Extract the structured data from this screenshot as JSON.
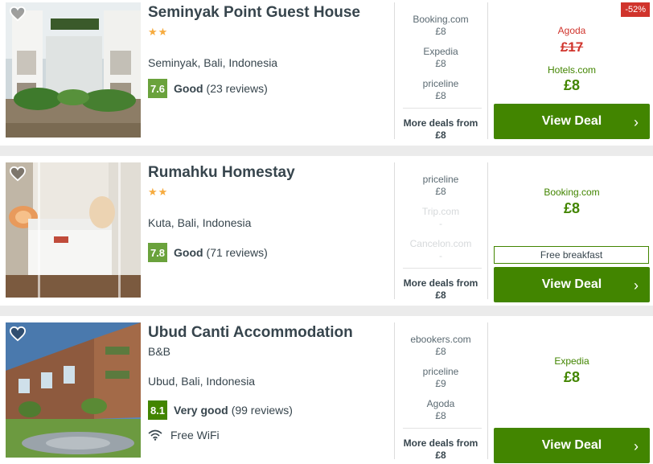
{
  "results": [
    {
      "name": "Seminyak Point Guest House",
      "stars": "★★",
      "location": "Seminyak, Bali, Indonesia",
      "rating": {
        "score": "7.6",
        "label": "Good",
        "count": "(23 reviews)"
      },
      "deals": [
        {
          "provider": "Booking.com",
          "price": "£8"
        },
        {
          "provider": "Expedia",
          "price": "£8"
        },
        {
          "provider": "priceline",
          "price": "£8"
        }
      ],
      "more_deals": {
        "label": "More deals from",
        "price": "£8"
      },
      "best": {
        "original_provider": "Agoda",
        "original_price": "£17",
        "provider": "Hotels.com",
        "price": "£8",
        "badge": "-52%"
      },
      "cta": "View Deal"
    },
    {
      "name": "Rumahku Homestay",
      "stars": "★★",
      "location": "Kuta, Bali, Indonesia",
      "rating": {
        "score": "7.8",
        "label": "Good",
        "count": "(71 reviews)"
      },
      "deals": [
        {
          "provider": "priceline",
          "price": "£8"
        },
        {
          "provider": "Trip.com",
          "price": "-"
        },
        {
          "provider": "Cancelon.com",
          "price": "-"
        }
      ],
      "more_deals": {
        "label": "More deals from",
        "price": "£8"
      },
      "best": {
        "provider": "Booking.com",
        "price": "£8",
        "extra": "Free breakfast"
      },
      "cta": "View Deal"
    },
    {
      "name": "Ubud Canti Accommodation",
      "type": "B&B",
      "location": "Ubud, Bali, Indonesia",
      "rating": {
        "score": "8.1",
        "label": "Very good",
        "count": "(99 reviews)"
      },
      "amenity": "Free WiFi",
      "deals": [
        {
          "provider": "ebookers.com",
          "price": "£8"
        },
        {
          "provider": "priceline",
          "price": "£9"
        },
        {
          "provider": "Agoda",
          "price": "£8"
        }
      ],
      "more_deals": {
        "label": "More deals from",
        "price": "£8"
      },
      "best": {
        "provider": "Expedia",
        "price": "£8"
      },
      "cta": "View Deal"
    }
  ],
  "colors": {
    "brand_green": "#428500",
    "alert_red": "#d0342c",
    "star_orange": "#f6ab3f",
    "text": "#37454d"
  },
  "icons": [
    "heart-outline-icon",
    "wifi-icon",
    "chevron-right-icon"
  ]
}
